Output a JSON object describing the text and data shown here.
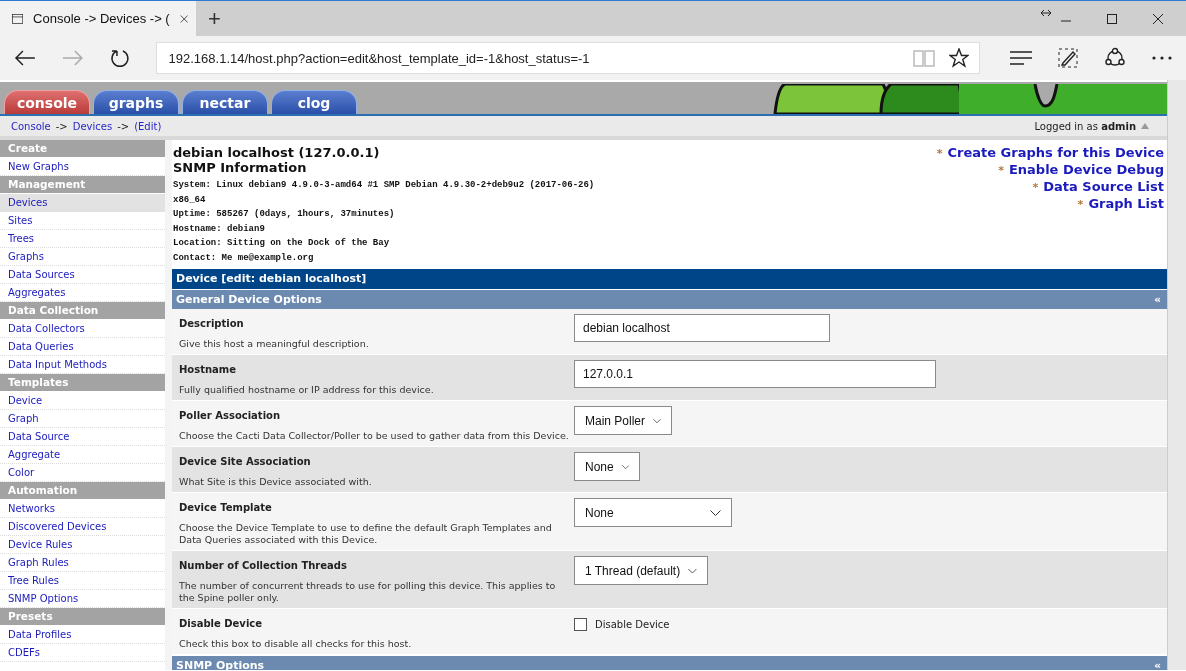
{
  "browser": {
    "tab_title": "Console -> Devices -> (",
    "new_tab": "+",
    "url": "192.168.1.14/host.php?action=edit&host_template_id=-1&host_status=-1"
  },
  "app_tabs": [
    {
      "label": "console",
      "selected": true
    },
    {
      "label": "graphs",
      "selected": false
    },
    {
      "label": "nectar",
      "selected": false
    },
    {
      "label": "clog",
      "selected": false
    }
  ],
  "breadcrumb": [
    "Console",
    "->",
    "Devices",
    "->",
    "(Edit)"
  ],
  "user": {
    "prefix": "Logged in as",
    "name": "admin"
  },
  "sidebar": [
    {
      "header": "Create",
      "items": [
        {
          "label": "New Graphs",
          "selected": false
        }
      ]
    },
    {
      "header": "Management",
      "items": [
        {
          "label": "Devices",
          "selected": true
        },
        {
          "label": "Sites",
          "selected": false
        },
        {
          "label": "Trees",
          "selected": false
        },
        {
          "label": "Graphs",
          "selected": false
        },
        {
          "label": "Data Sources",
          "selected": false
        },
        {
          "label": "Aggregates",
          "selected": false
        }
      ]
    },
    {
      "header": "Data Collection",
      "items": [
        {
          "label": "Data Collectors",
          "selected": false
        },
        {
          "label": "Data Queries",
          "selected": false
        },
        {
          "label": "Data Input Methods",
          "selected": false
        }
      ]
    },
    {
      "header": "Templates",
      "items": [
        {
          "label": "Device",
          "selected": false
        },
        {
          "label": "Graph",
          "selected": false
        },
        {
          "label": "Data Source",
          "selected": false
        },
        {
          "label": "Aggregate",
          "selected": false
        },
        {
          "label": "Color",
          "selected": false
        }
      ]
    },
    {
      "header": "Automation",
      "items": [
        {
          "label": "Networks",
          "selected": false
        },
        {
          "label": "Discovered Devices",
          "selected": false
        },
        {
          "label": "Device Rules",
          "selected": false
        },
        {
          "label": "Graph Rules",
          "selected": false
        },
        {
          "label": "Tree Rules",
          "selected": false
        },
        {
          "label": "SNMP Options",
          "selected": false
        }
      ]
    },
    {
      "header": "Presets",
      "items": [
        {
          "label": "Data Profiles",
          "selected": false
        },
        {
          "label": "CDEFs",
          "selected": false
        }
      ]
    }
  ],
  "device": {
    "title": "debian localhost (127.0.0.1)",
    "subtitle": "SNMP Information",
    "snmp_lines": [
      "System: Linux debian9 4.9.0-3-amd64 #1 SMP Debian 4.9.30-2+deb9u2 (2017-06-26)",
      "x86_64",
      "Uptime: 585267 (0days, 1hours, 37minutes)",
      "Hostname: debian9",
      "Location: Sitting on the Dock of the Bay",
      "Contact: Me me@example.org"
    ],
    "bullet": "*",
    "links": [
      "Create Graphs for this Device",
      "Enable Device Debug",
      "Data Source List",
      "Graph List"
    ]
  },
  "form": {
    "title": "Device [edit: debian localhost]",
    "section": "General Device Options",
    "collapse": "«",
    "fields": [
      {
        "kind": "text",
        "label": "Description",
        "help": "Give this host a meaningful description.",
        "value": "debian localhost"
      },
      {
        "kind": "text",
        "label": "Hostname",
        "help": "Fully qualified hostname or IP address for this device.",
        "value": "127.0.0.1"
      },
      {
        "kind": "select",
        "label": "Poller Association",
        "help": "Choose the Cacti Data Collector/Poller to be used to gather data from this Device.",
        "value": "Main Poller"
      },
      {
        "kind": "select",
        "label": "Device Site Association",
        "help": "What Site is this Device associated with.",
        "value": "None"
      },
      {
        "kind": "select",
        "label": "Device Template",
        "help": "Choose the Device Template to use to define the default Graph Templates and Data Queries associated with this Device.",
        "value": "None"
      },
      {
        "kind": "select",
        "label": "Number of Collection Threads",
        "help": "The number of concurrent threads to use for polling this device. This applies to the Spine poller only.",
        "value": "1 Thread (default)"
      },
      {
        "kind": "checkbox",
        "label": "Disable Device",
        "help": "Check this box to disable all checks for this host.",
        "value": "Disable Device",
        "checked": false
      }
    ],
    "next_section": "SNMP Options"
  }
}
